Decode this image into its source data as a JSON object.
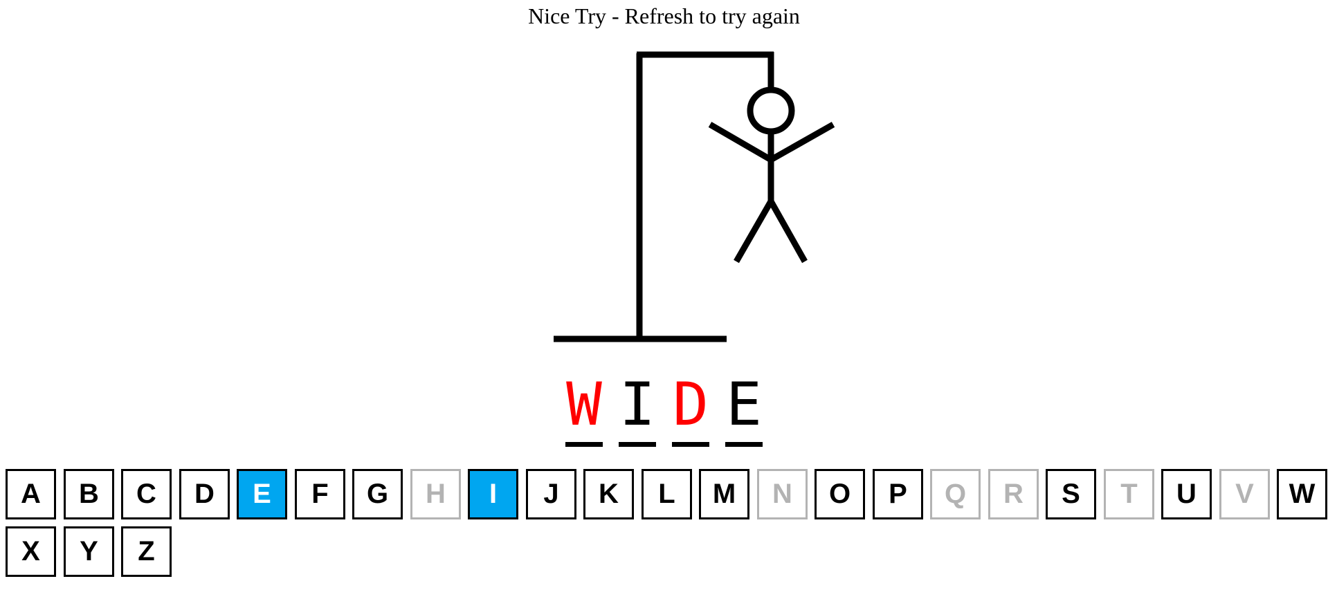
{
  "status_message": "Nice Try - Refresh to try again",
  "word": [
    {
      "letter": "W",
      "state": "missed"
    },
    {
      "letter": "I",
      "state": "found"
    },
    {
      "letter": "D",
      "state": "missed"
    },
    {
      "letter": "E",
      "state": "found"
    }
  ],
  "keyboard": [
    {
      "letter": "A",
      "state": "available"
    },
    {
      "letter": "B",
      "state": "available"
    },
    {
      "letter": "C",
      "state": "available"
    },
    {
      "letter": "D",
      "state": "available"
    },
    {
      "letter": "E",
      "state": "correct"
    },
    {
      "letter": "F",
      "state": "available"
    },
    {
      "letter": "G",
      "state": "available"
    },
    {
      "letter": "H",
      "state": "used"
    },
    {
      "letter": "I",
      "state": "correct"
    },
    {
      "letter": "J",
      "state": "available"
    },
    {
      "letter": "K",
      "state": "available"
    },
    {
      "letter": "L",
      "state": "available"
    },
    {
      "letter": "M",
      "state": "available"
    },
    {
      "letter": "N",
      "state": "used"
    },
    {
      "letter": "O",
      "state": "available"
    },
    {
      "letter": "P",
      "state": "available"
    },
    {
      "letter": "Q",
      "state": "used"
    },
    {
      "letter": "R",
      "state": "used"
    },
    {
      "letter": "S",
      "state": "available"
    },
    {
      "letter": "T",
      "state": "used"
    },
    {
      "letter": "U",
      "state": "available"
    },
    {
      "letter": "V",
      "state": "used"
    },
    {
      "letter": "W",
      "state": "available"
    },
    {
      "letter": "X",
      "state": "available"
    },
    {
      "letter": "Y",
      "state": "available"
    },
    {
      "letter": "Z",
      "state": "available"
    }
  ],
  "drawing": {
    "stroke_color": "#000000",
    "parts_shown": [
      "base",
      "pole",
      "beam",
      "rope",
      "head",
      "body",
      "left-arm",
      "right-arm",
      "left-leg",
      "right-leg"
    ]
  },
  "colors": {
    "missed_letter": "#ff0000",
    "correct_key": "#00a6f0",
    "used_key": "#b3b3b3"
  }
}
